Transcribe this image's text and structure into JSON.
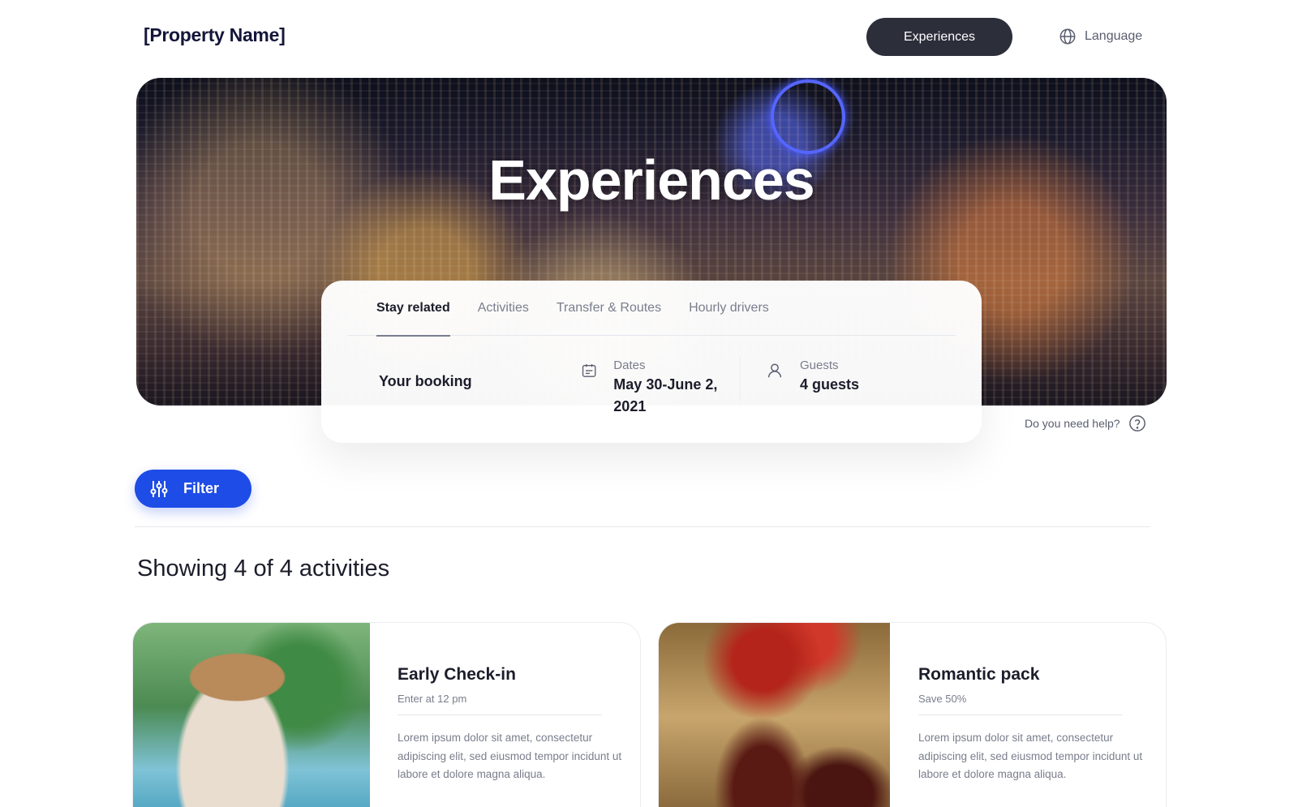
{
  "header": {
    "logo": "[Property Name]",
    "nav_button": "Experiences",
    "language": "Language"
  },
  "hero": {
    "title": "Experiences"
  },
  "booking": {
    "tabs": [
      "Stay related",
      "Activities",
      "Transfer & Routes",
      "Hourly drivers"
    ],
    "active_tab": "Stay related",
    "label": "Your booking",
    "dates_label": "Dates",
    "dates_value": "May 30-June 2, 2021",
    "guests_label": "Guests",
    "guests_value": "4 guests"
  },
  "help": {
    "text": "Do you need help?"
  },
  "filter": {
    "label": "Filter"
  },
  "results": {
    "summary": "Showing 4 of 4 activities"
  },
  "cards": [
    {
      "title": "Early Check-in",
      "subtitle": "Enter at 12 pm",
      "description": "Lorem ipsum dolor sit amet, consectetur adipiscing elit, sed eiusmod tempor incidunt ut labore et dolore magna aliqua."
    },
    {
      "title": "Romantic pack",
      "subtitle": "Save 50%",
      "description": "Lorem ipsum dolor sit amet, consectetur adipiscing elit, sed eiusmod tempor incidunt ut labore et dolore magna aliqua."
    }
  ],
  "colors": {
    "primary": "#1e4ce6",
    "dark_button": "#2c2f3a",
    "text": "#1c1d2b",
    "muted": "#7a7d8c"
  },
  "icons": [
    "globe-icon",
    "calendar-icon",
    "person-icon",
    "help-icon",
    "sliders-icon"
  ]
}
